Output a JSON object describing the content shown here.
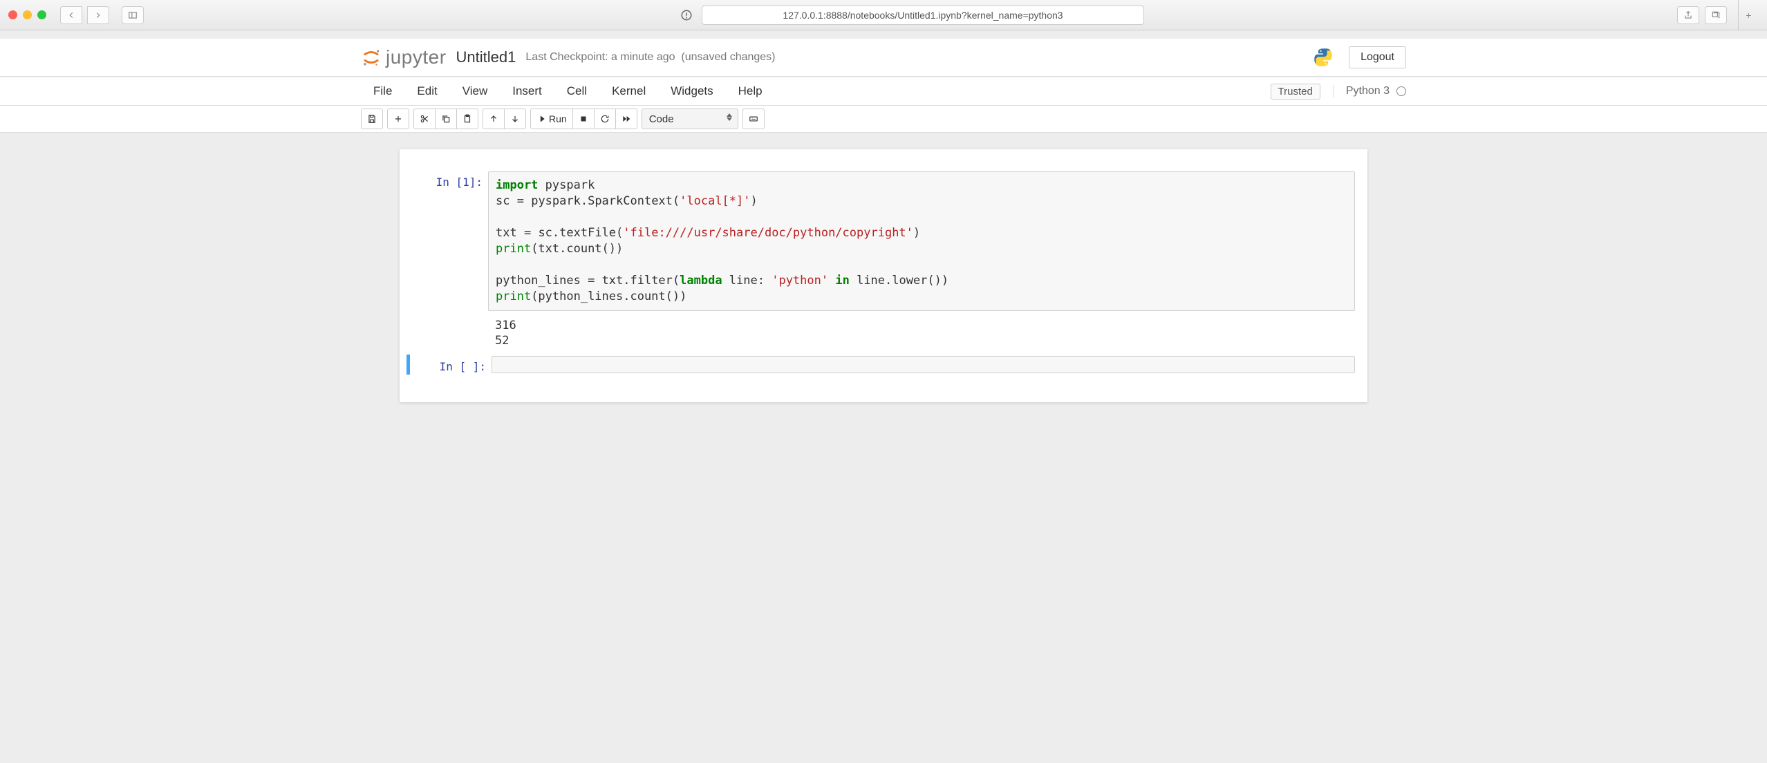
{
  "browser": {
    "url": "127.0.0.1:8888/notebooks/Untitled1.ipynb?kernel_name=python3"
  },
  "header": {
    "logo_text": "jupyter",
    "notebook_name": "Untitled1",
    "checkpoint": "Last Checkpoint: a minute ago",
    "autosave": "(unsaved changes)",
    "logout": "Logout"
  },
  "menubar": {
    "items": [
      "File",
      "Edit",
      "View",
      "Insert",
      "Cell",
      "Kernel",
      "Widgets",
      "Help"
    ],
    "trusted": "Trusted",
    "kernel_name": "Python 3"
  },
  "toolbar": {
    "run_label": "Run",
    "cell_type": "Code"
  },
  "cells": [
    {
      "prompt": "In [1]:",
      "code_tokens": [
        {
          "t": "import",
          "c": "kw"
        },
        {
          "t": " pyspark\n"
        },
        {
          "t": "sc "
        },
        {
          "t": "="
        },
        {
          "t": " pyspark.SparkContext("
        },
        {
          "t": "'local[*]'",
          "c": "str"
        },
        {
          "t": ")\n"
        },
        {
          "t": "\n"
        },
        {
          "t": "txt "
        },
        {
          "t": "="
        },
        {
          "t": " sc.textFile("
        },
        {
          "t": "'file:////usr/share/doc/python/copyright'",
          "c": "str"
        },
        {
          "t": ")\n"
        },
        {
          "t": "print",
          "c": "builtin"
        },
        {
          "t": "(txt.count())\n"
        },
        {
          "t": "\n"
        },
        {
          "t": "python_lines "
        },
        {
          "t": "="
        },
        {
          "t": " txt.filter("
        },
        {
          "t": "lambda",
          "c": "kw"
        },
        {
          "t": " line: "
        },
        {
          "t": "'python'",
          "c": "str"
        },
        {
          "t": " "
        },
        {
          "t": "in",
          "c": "kw"
        },
        {
          "t": " line.lower())\n"
        },
        {
          "t": "print",
          "c": "builtin"
        },
        {
          "t": "(python_lines.count())"
        }
      ],
      "output": "316\n52"
    },
    {
      "prompt": "In [ ]:",
      "code_tokens": [],
      "output": null
    }
  ]
}
